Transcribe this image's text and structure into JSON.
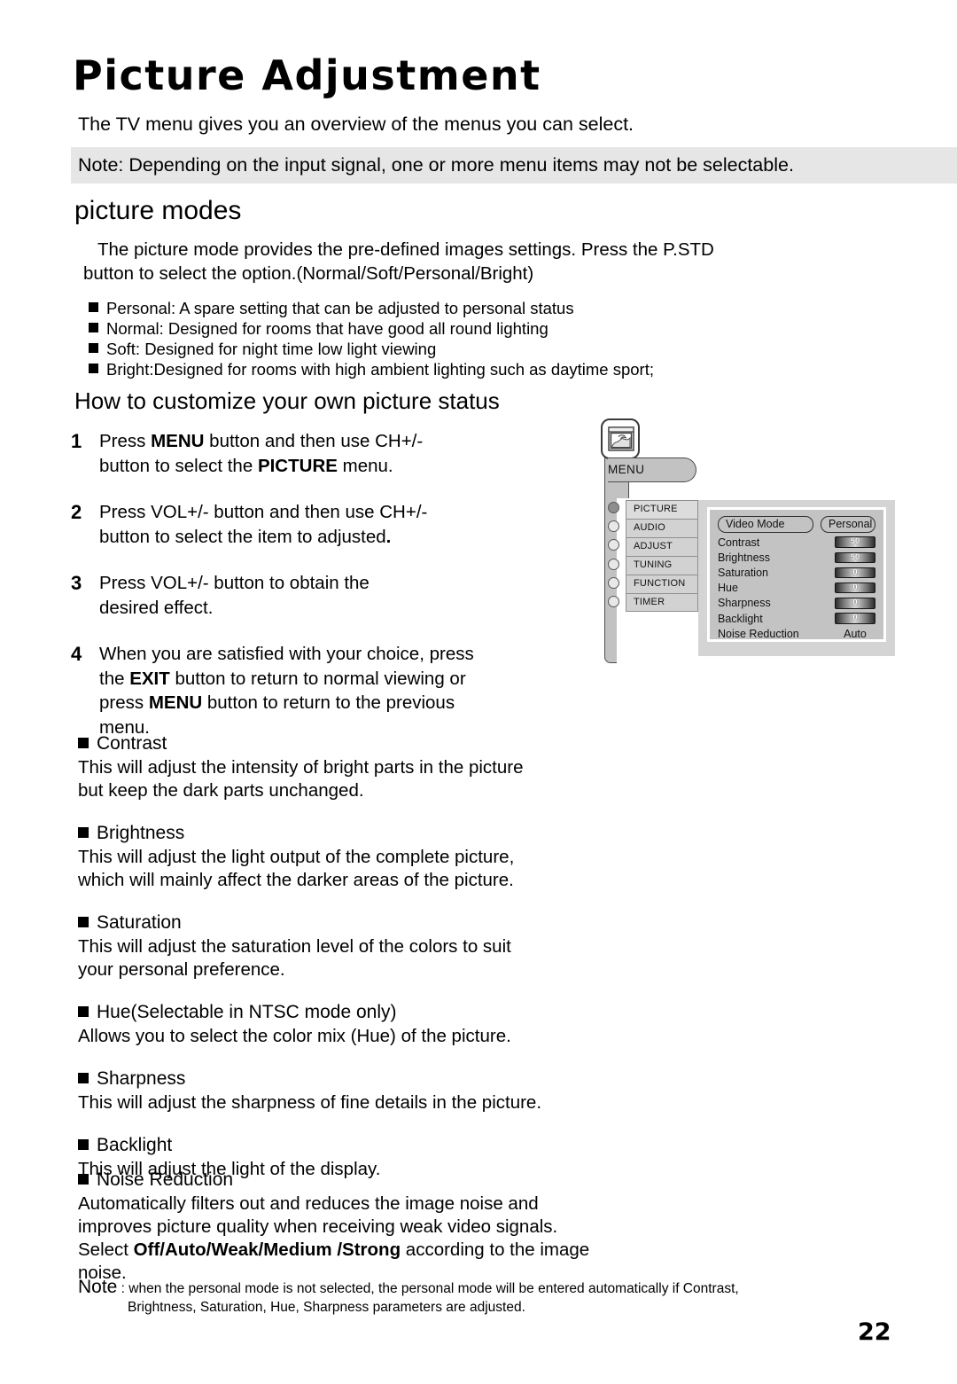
{
  "header": {
    "title": "Picture Adjustment",
    "intro": "The TV menu gives you an overview of the menus you can select.",
    "note_band": "Note: Depending on the input signal, one or more menu items may not be selectable."
  },
  "picture_modes": {
    "heading": "picture modes",
    "para_line1": "The picture mode provides the pre-defined images settings. Press the P.STD",
    "para_line2": "button to select the option.(Normal/Soft/Personal/Bright)",
    "items": [
      "Personal: A spare setting that can be adjusted to personal status",
      "Normal: Designed for rooms that have good all round lighting",
      "Soft: Designed for night time low light viewing",
      "Bright:Designed for rooms with high ambient lighting such as daytime sport;"
    ]
  },
  "customize": {
    "heading": "How to customize your own picture status",
    "steps": [
      {
        "num": "1",
        "parts": [
          {
            "t": "Press ",
            "b": false
          },
          {
            "t": "MENU",
            "b": true
          },
          {
            "t": " button and then use CH+/-",
            "b": false
          },
          {
            "t": "\n",
            "b": false
          },
          {
            "t": "button to select the ",
            "b": false
          },
          {
            "t": "PICTURE",
            "b": true
          },
          {
            "t": " menu.",
            "b": false
          }
        ]
      },
      {
        "num": "2",
        "parts": [
          {
            "t": "Press VOL+/- button and then use CH+/-",
            "b": false
          },
          {
            "t": "\n",
            "b": false
          },
          {
            "t": "button to select the item to adjusted",
            "b": false
          },
          {
            "t": ".",
            "b": true
          }
        ]
      },
      {
        "num": "3",
        "parts": [
          {
            "t": "Press VOL+/- button to obtain the",
            "b": false
          },
          {
            "t": "\n",
            "b": false
          },
          {
            "t": "desired effect.",
            "b": false
          }
        ]
      },
      {
        "num": "4",
        "parts": [
          {
            "t": "When you are satisfied with your choice, press",
            "b": false
          },
          {
            "t": "\n",
            "b": false
          },
          {
            "t": "the ",
            "b": false
          },
          {
            "t": "EXIT",
            "b": true
          },
          {
            "t": " button to return to normal viewing or",
            "b": false
          },
          {
            "t": "\n",
            "b": false
          },
          {
            "t": "press ",
            "b": false
          },
          {
            "t": "MENU",
            "b": true
          },
          {
            "t": " button to return to the previous",
            "b": false
          },
          {
            "t": "\n",
            "b": false
          },
          {
            "t": "menu.",
            "b": false
          }
        ]
      }
    ]
  },
  "definitions": [
    {
      "term": "Contrast",
      "lines": [
        "This will adjust the intensity of bright parts in the picture",
        "but keep the dark parts unchanged."
      ]
    },
    {
      "term": "Brightness",
      "lines": [
        "This will adjust the light output of the complete picture,",
        "which will mainly affect the darker areas of the picture."
      ]
    },
    {
      "term": "Saturation",
      "lines": [
        "This will adjust the saturation level of the colors to suit",
        "your personal preference."
      ]
    },
    {
      "term": "Hue(Selectable in NTSC mode only)",
      "lines": [
        "Allows you to select the color mix (Hue) of the picture."
      ]
    },
    {
      "term": "Sharpness",
      "lines": [
        "This will adjust the sharpness of fine details in the picture."
      ]
    },
    {
      "term": "Backlight",
      "lines": [
        "This will adjust the light of the display."
      ]
    }
  ],
  "noise_reduction": {
    "term": "Noise Reduction",
    "line1": "Automatically filters out and reduces the image noise and",
    "line2": "improves picture quality when receiving weak video signals.",
    "line3_prefix": "Select ",
    "line3_bold": "Off/Auto/Weak/Medium /Strong",
    "line3_suffix": " according to the image",
    "line4": "noise."
  },
  "final_note": {
    "label": "Note",
    "line1": " : when the personal mode is not selected, the personal mode will be entered automatically if Contrast,",
    "line2": "Brightness, Saturation, Hue, Sharpness parameters are adjusted."
  },
  "page_number": "22",
  "osd": {
    "icon_name": "picture-landscape-icon",
    "menu_tab_label": "MENU",
    "menu_items": [
      {
        "label": "PICTURE",
        "selected": true
      },
      {
        "label": "AUDIO",
        "selected": false
      },
      {
        "label": "ADJUST",
        "selected": false
      },
      {
        "label": "TUNING",
        "selected": false
      },
      {
        "label": "FUNCTION",
        "selected": false
      },
      {
        "label": "TIMER",
        "selected": false
      }
    ],
    "video_mode_label": "Video Mode",
    "video_mode_value": "Personal",
    "settings": [
      {
        "label": "Contrast",
        "value": "50",
        "type": "badge"
      },
      {
        "label": "Brightness",
        "value": "50",
        "type": "badge"
      },
      {
        "label": "Saturation",
        "value": "0",
        "type": "badge"
      },
      {
        "label": "Hue",
        "value": "0",
        "type": "badge"
      },
      {
        "label": "Sharpness",
        "value": "0",
        "type": "badge"
      },
      {
        "label": "Backlight",
        "value": "0",
        "type": "badge"
      },
      {
        "label": "Noise Reduction",
        "value": "Auto",
        "type": "text"
      }
    ]
  },
  "colors": {
    "note_band_bg": "#e6e6e6",
    "osd_bar": "#c2c2c2",
    "osd_panel": "#d4d4d4",
    "osd_panel_inner": "#c3c3c3",
    "osd_item": "#d2d2d2"
  }
}
